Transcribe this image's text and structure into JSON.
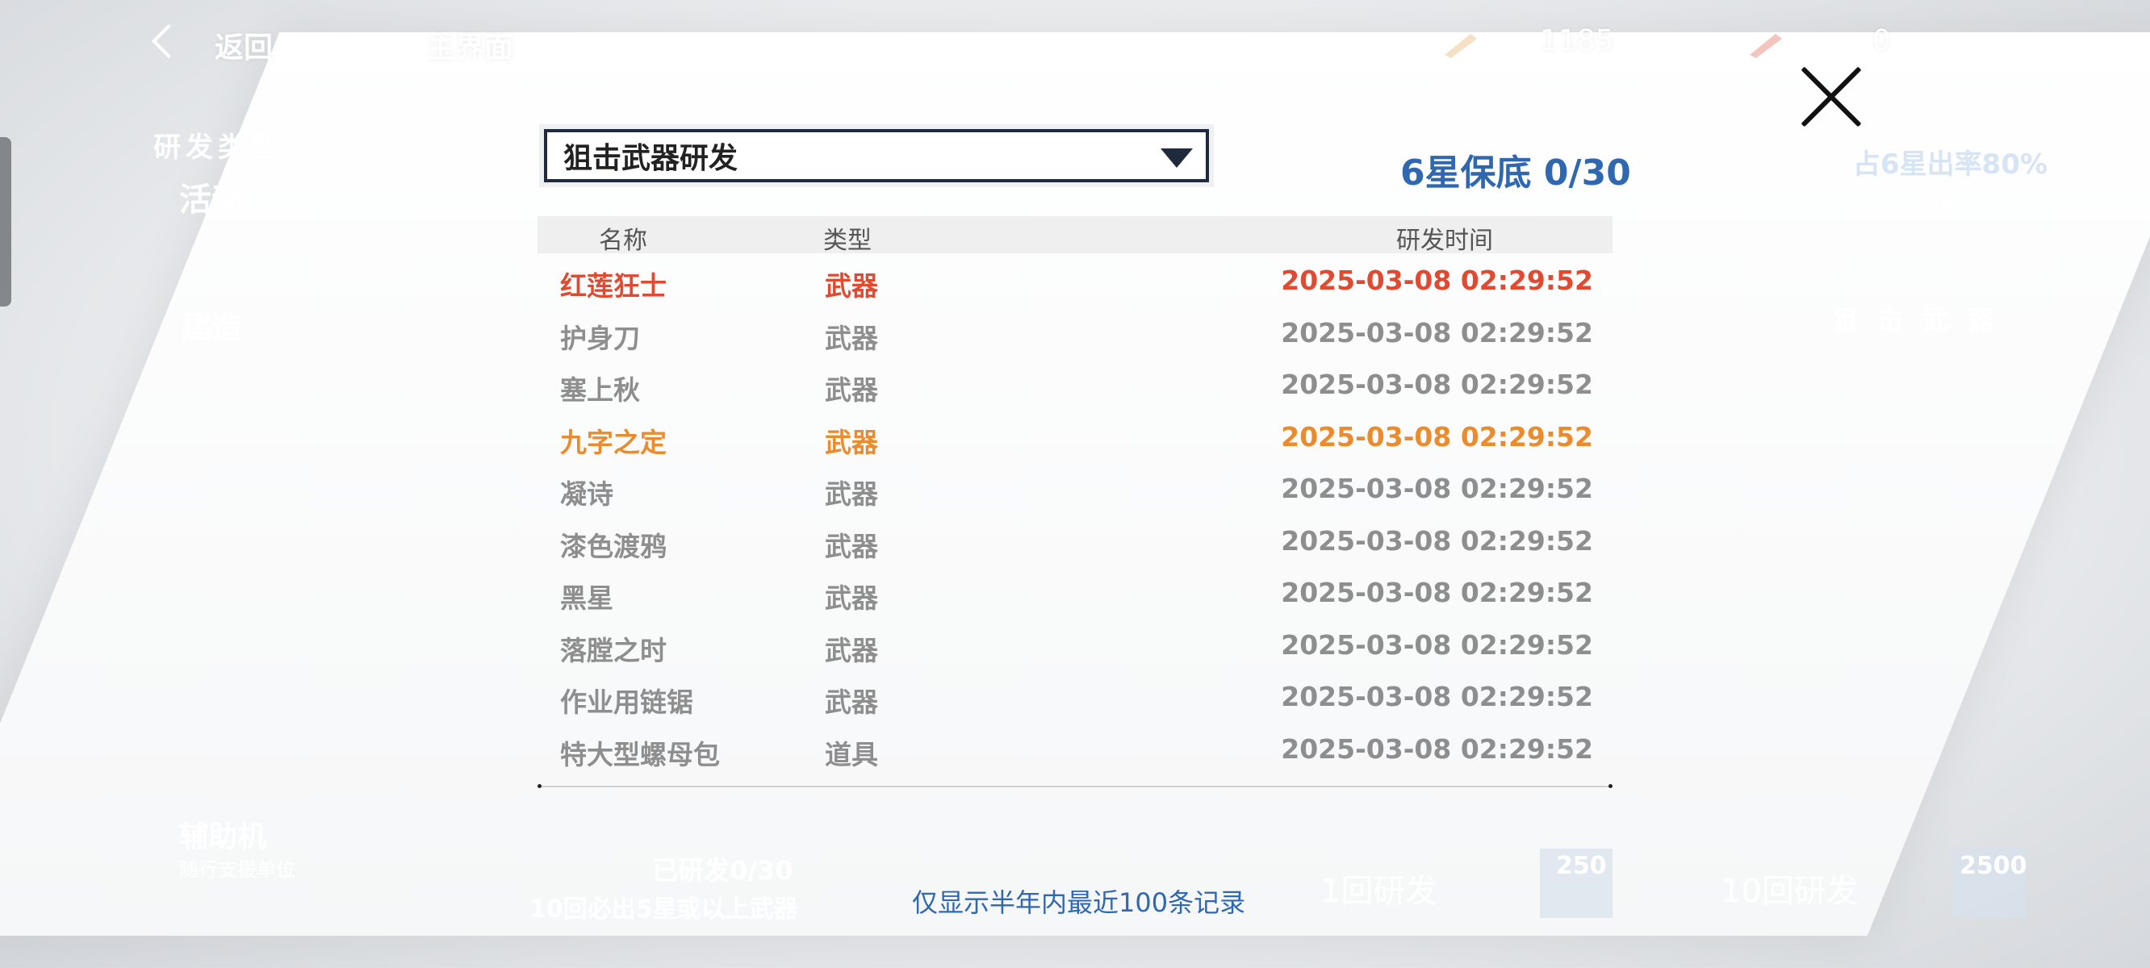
{
  "topbar": {
    "back_label": "返回",
    "home_label": "主界面",
    "currency1": "1185",
    "currency2": "0",
    "plus": "+"
  },
  "background": {
    "category_title": "研发类型",
    "category_activity": "活动",
    "category_build": "建造",
    "category_support": "辅助机",
    "category_support_sub": "随行支援单位",
    "rate_text": "占6星出率80%",
    "switch_label": "切换组合",
    "banner_label": "狙击武器",
    "progress_label": "已研发0/30",
    "guarantee_text": "10回必出5星或以上武器",
    "btn_single": "1回研发",
    "btn_single_cost": "250",
    "btn_ten": "10回研发",
    "btn_ten_cost": "2500"
  },
  "dialog": {
    "dropdown_value": "狙击武器研发",
    "pity": "6星保底 0/30",
    "headers": {
      "name": "名称",
      "type": "类型",
      "time": "研发时间"
    },
    "rows": [
      {
        "name": "红莲狂士",
        "type": "武器",
        "time": "2025-03-08 02:29:52"
      },
      {
        "name": "护身刀",
        "type": "武器",
        "time": "2025-03-08 02:29:52"
      },
      {
        "name": "塞上秋",
        "type": "武器",
        "time": "2025-03-08 02:29:52"
      },
      {
        "name": "九字之定",
        "type": "武器",
        "time": "2025-03-08 02:29:52"
      },
      {
        "name": "凝诗",
        "type": "武器",
        "time": "2025-03-08 02:29:52"
      },
      {
        "name": "漆色渡鸦",
        "type": "武器",
        "time": "2025-03-08 02:29:52"
      },
      {
        "name": "黑星",
        "type": "武器",
        "time": "2025-03-08 02:29:52"
      },
      {
        "name": "落膛之时",
        "type": "武器",
        "time": "2025-03-08 02:29:52"
      },
      {
        "name": "作业用链锯",
        "type": "武器",
        "time": "2025-03-08 02:29:52"
      },
      {
        "name": "特大型螺母包",
        "type": "道具",
        "time": "2025-03-08 02:29:52"
      }
    ],
    "footnote": "仅显示半年内最近100条记录"
  },
  "colors": {
    "rarity_high": "#df4a30",
    "rarity_mid": "#ea8b2e",
    "normal": "#8e8e8e",
    "accent": "#2f67b1"
  }
}
